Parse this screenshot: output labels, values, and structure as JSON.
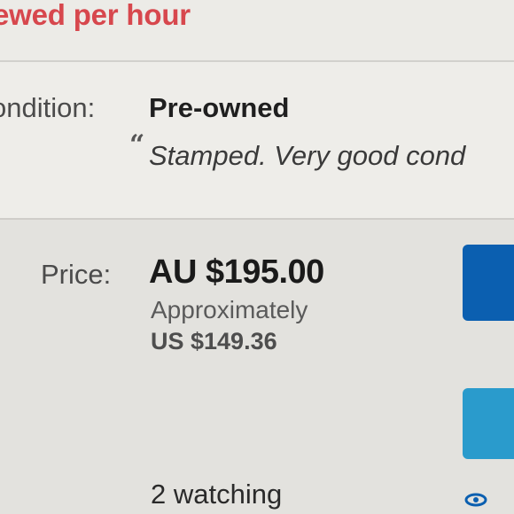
{
  "header": {
    "views_text": "ewed per hour"
  },
  "condition": {
    "label": "ondition:",
    "value": "Pre-owned",
    "quote_mark": "“",
    "description": "Stamped. Very good cond"
  },
  "price": {
    "label": "Price:",
    "value": "AU $195.00",
    "approx_label": "Approximately",
    "approx_value": "US $149.36"
  },
  "watchers": {
    "text": "2 watching"
  },
  "colors": {
    "views_accent": "#d7474d",
    "primary_button": "#0b5fb0",
    "secondary_button": "#2a9bcc"
  },
  "icons": {
    "watch": "eye-icon"
  }
}
